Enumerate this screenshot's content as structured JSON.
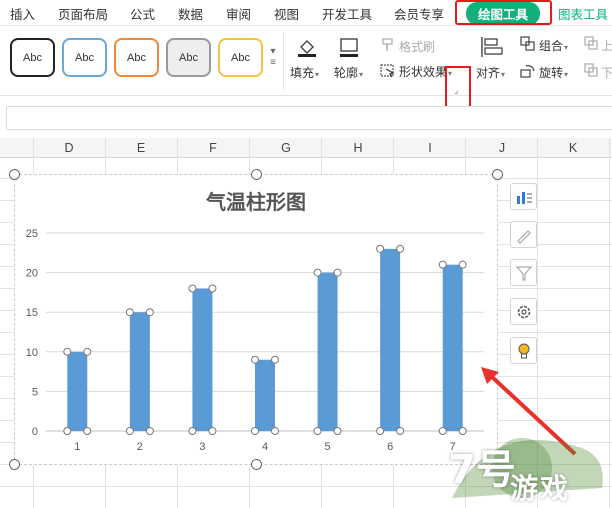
{
  "menu": {
    "items": [
      "插入",
      "页面布局",
      "公式",
      "数据",
      "审阅",
      "视图",
      "开发工具",
      "会员专享"
    ],
    "active_tab": "绘图工具",
    "chart_tools_tab": "图表工具"
  },
  "ribbon": {
    "style_preset_label": "Abc",
    "fill_label": "填充",
    "outline_label": "轮廓",
    "format_painter_label": "格式刷",
    "shape_effects_label": "形状效果",
    "align_label": "对齐",
    "group_label": "组合",
    "rotate_label": "旋转",
    "up_label": "上",
    "down_label": "下"
  },
  "sheet": {
    "columns": [
      "D",
      "E",
      "F",
      "G",
      "H",
      "I",
      "J",
      "K"
    ]
  },
  "chart_tools": {
    "icons": [
      "chart-elements-icon",
      "chart-style-icon",
      "chart-filter-icon",
      "chart-settings-icon",
      "chart-ideas-icon"
    ]
  },
  "colors": {
    "accent_green": "#12b17a",
    "highlight_red": "#e31b1b",
    "bar_blue": "#5b9bd5",
    "arrow_red": "#e8302c"
  },
  "chart_data": {
    "type": "bar",
    "title": "气温柱形图",
    "categories": [
      "1",
      "2",
      "3",
      "4",
      "5",
      "6",
      "7"
    ],
    "values": [
      10,
      15,
      18,
      9,
      20,
      23,
      21
    ],
    "ylim": [
      0,
      25
    ],
    "yticks": [
      "0",
      "5",
      "10",
      "15",
      "20",
      "25"
    ],
    "grid": true,
    "legend": "none"
  },
  "watermark": {
    "number": "7号",
    "text": "游戏"
  }
}
